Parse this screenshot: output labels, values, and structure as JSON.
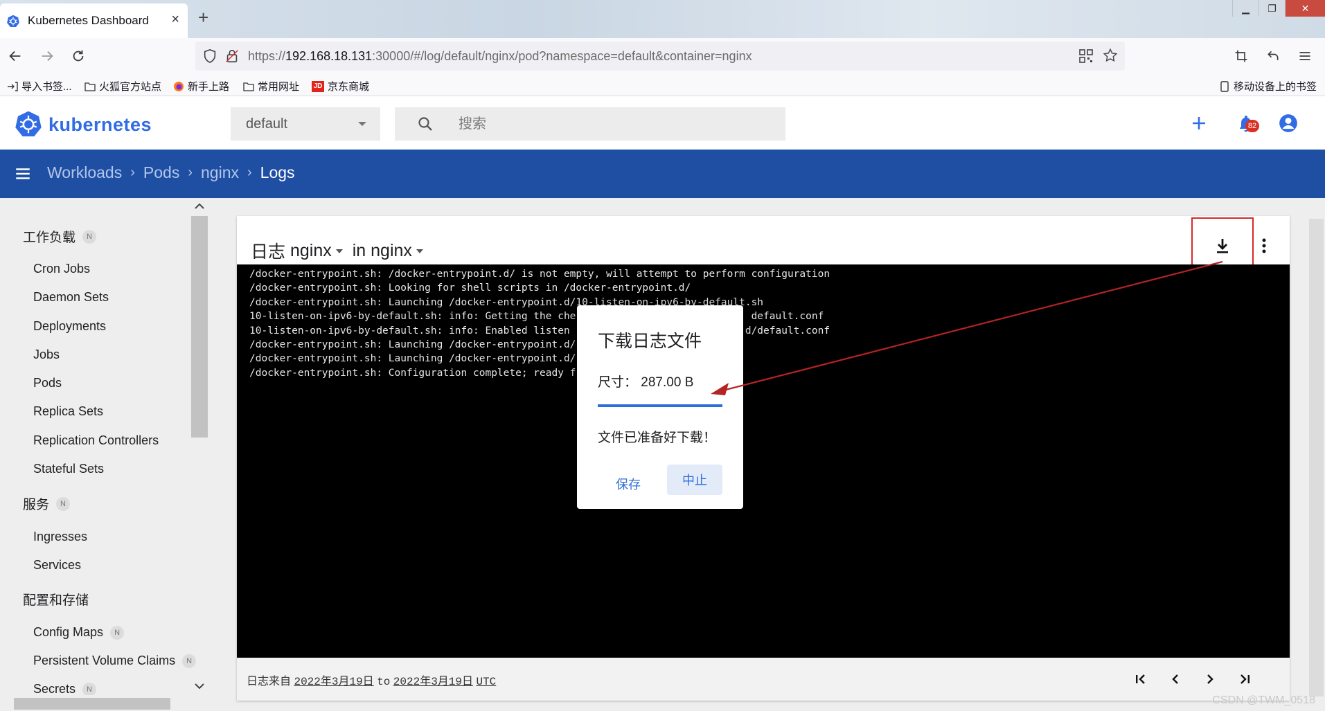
{
  "browser": {
    "tab_title": "Kubernetes Dashboard",
    "tab_close": "×",
    "new_tab": "+",
    "url_prefix": "https://",
    "url_host": "192.168.18.131",
    "url_rest": ":30000/#/log/default/nginx/pod?namespace=default&container=nginx",
    "bookmarks": [
      "导入书签...",
      "火狐官方站点",
      "新手上路",
      "常用网址",
      "京东商城"
    ],
    "mobile_bookmarks": "移动设备上的书签"
  },
  "header": {
    "brand": "kubernetes",
    "namespace": "default",
    "search_placeholder": "搜索",
    "notifications_count": "82"
  },
  "breadcrumbs": [
    "Workloads",
    "Pods",
    "nginx",
    "Logs"
  ],
  "sidebar": {
    "sections": [
      {
        "label": "工作负载",
        "badge": "N",
        "items": [
          "Cron Jobs",
          "Daemon Sets",
          "Deployments",
          "Jobs",
          "Pods",
          "Replica Sets",
          "Replication Controllers",
          "Stateful Sets"
        ]
      },
      {
        "label": "服务",
        "badge": "N",
        "items": [
          "Ingresses",
          "Services"
        ]
      },
      {
        "label": "配置和存储",
        "badge": "",
        "items": [
          "Config Maps",
          "Persistent Volume Claims",
          "Secrets"
        ],
        "item_badges": [
          "N",
          "N",
          "N"
        ]
      }
    ]
  },
  "log_card": {
    "title_prefix": "日志",
    "pod": "nginx",
    "container_prefix": "in",
    "container": "nginx",
    "lines": [
      "/docker-entrypoint.sh: /docker-entrypoint.d/ is not empty, will attempt to perform configuration",
      "/docker-entrypoint.sh: Looking for shell scripts in /docker-entrypoint.d/",
      "/docker-entrypoint.sh: Launching /docker-entrypoint.d/10-listen-on-ipv6-by-default.sh",
      "10-listen-on-ipv6-by-default.sh: info: Getting the che                             default.conf",
      "10-listen-on-ipv6-by-default.sh: info: Enabled listen                             d/default.conf",
      "/docker-entrypoint.sh: Launching /docker-entrypoint.d/",
      "/docker-entrypoint.sh: Launching /docker-entrypoint.d/",
      "/docker-entrypoint.sh: Configuration complete; ready f"
    ],
    "footer_prefix": "日志来自",
    "from_date": "2022年3月19日",
    "to_word": "to",
    "to_date": "2022年3月19日",
    "tz": "UTC"
  },
  "dialog": {
    "title": "下载日志文件",
    "size_label": "尺寸：",
    "size_value": "287.00 B",
    "progress_percent": 100,
    "message": "文件已准备好下载！",
    "save_label": "保存",
    "abort_label": "中止"
  },
  "watermark": "CSDN @TWM_0518",
  "colors": {
    "brand_blue": "#326ce5",
    "breadcrumb_bar": "#1f4fa3",
    "log_background": "#000000",
    "annotation_red": "#d42a2a",
    "dialog_accent": "#2f6fd8"
  }
}
